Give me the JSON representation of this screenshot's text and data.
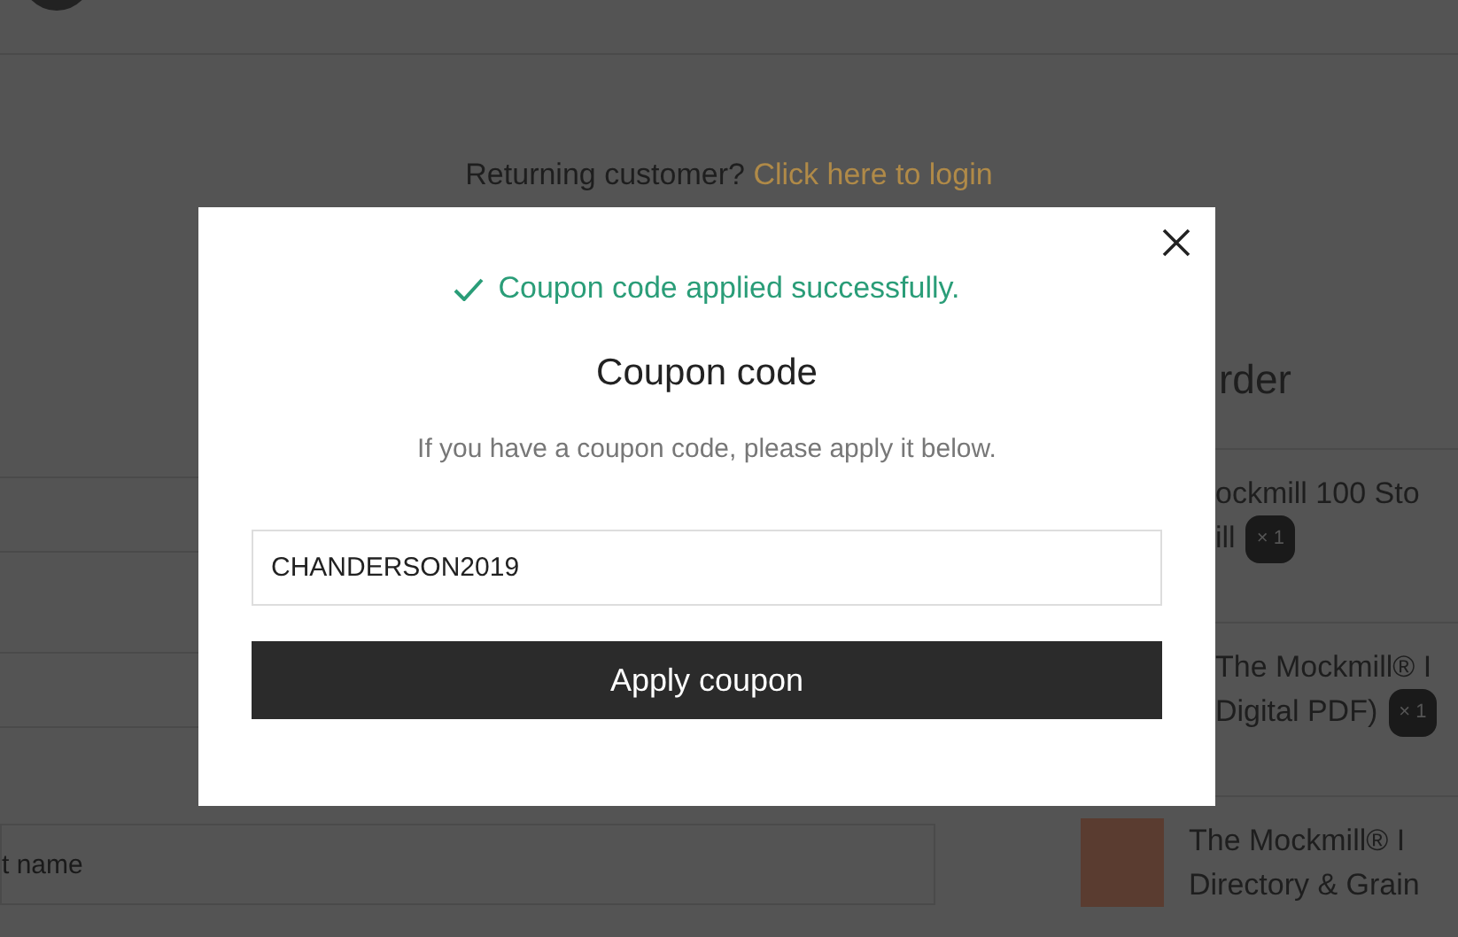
{
  "returning": {
    "text": "Returning customer?",
    "link": "Click here to login"
  },
  "billing": {
    "field_placeholder": "t name"
  },
  "order": {
    "heading": "rder",
    "items": [
      {
        "lines": [
          "ockmill 100 Sto",
          "ill"
        ],
        "quantity": "× 1",
        "thumbnail": false
      },
      {
        "lines": [
          "The Mockmill® I",
          "Digital PDF)"
        ],
        "quantity": "× 1",
        "thumbnail": false
      },
      {
        "lines": [
          "The Mockmill® I",
          "Directory & Grain"
        ],
        "thumbnail": true
      }
    ]
  },
  "modal": {
    "message": "Coupon code applied successfully.",
    "title": "Coupon code",
    "description": "If you have a coupon code, please apply it below.",
    "coupon_value": "CHANDERSON2019",
    "button": "Apply coupon"
  }
}
